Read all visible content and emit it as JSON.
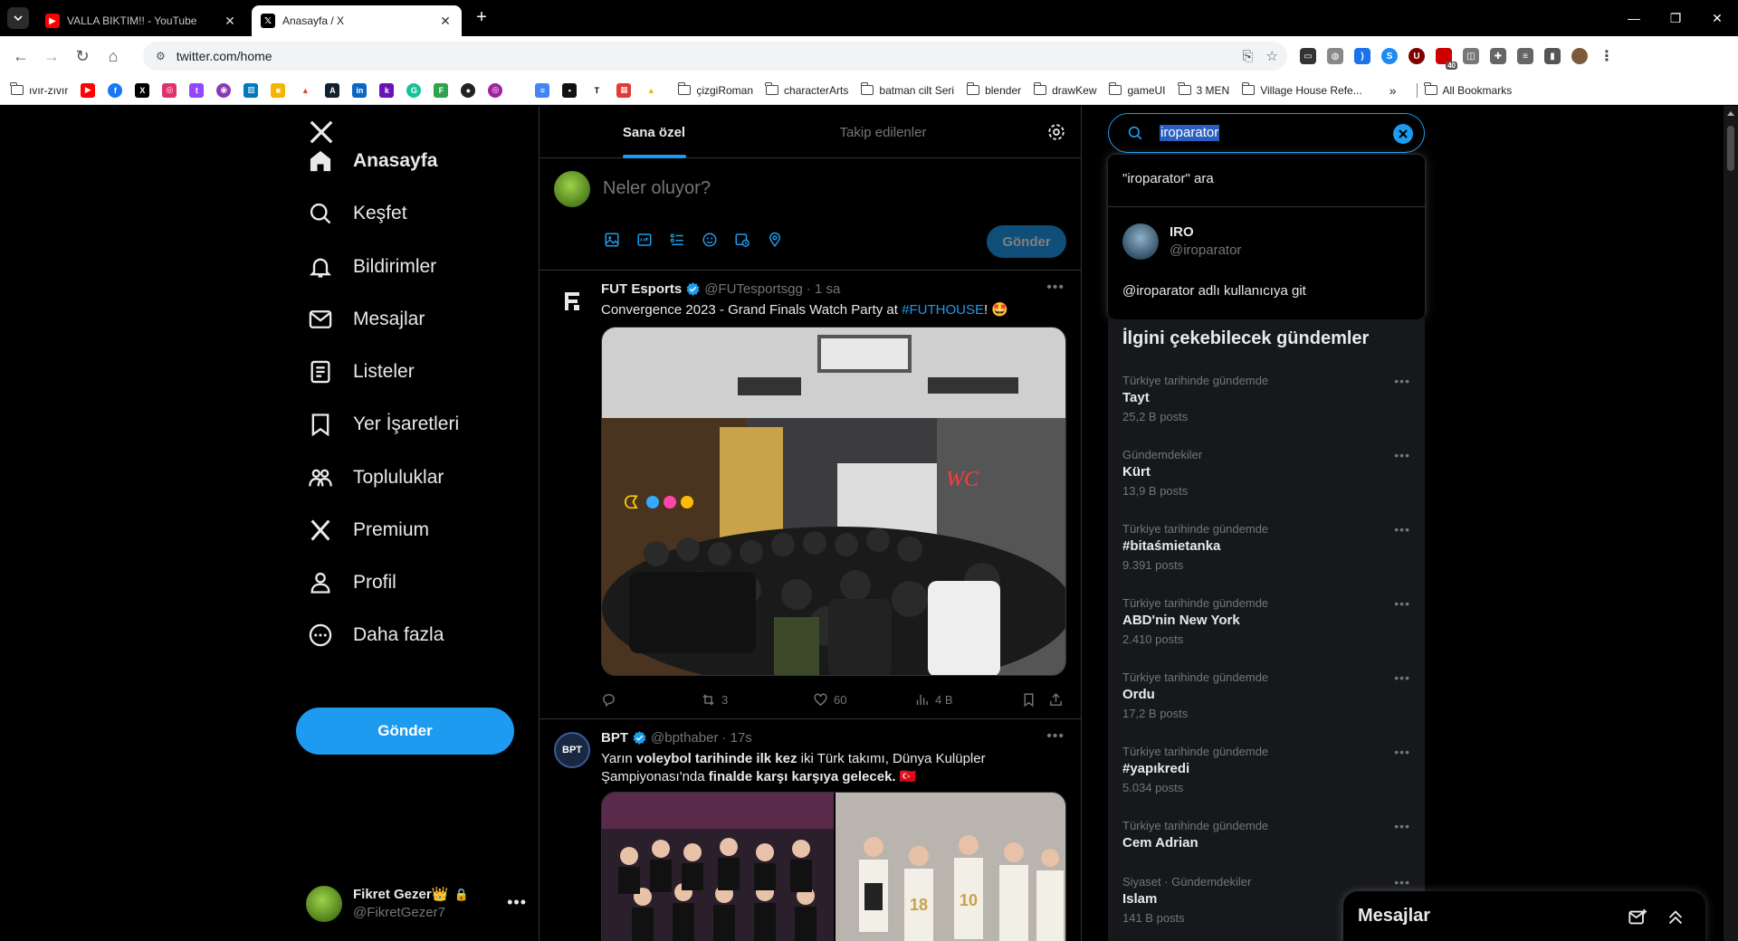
{
  "browser": {
    "tabs": [
      {
        "title": "VALLA BIKTIM!! - YouTube",
        "favicon": "youtube-icon"
      },
      {
        "title": "Anasayfa / X",
        "favicon": "x-icon"
      }
    ],
    "url": "twitter.com/home",
    "bookmarks": [
      {
        "label": "ıvır-zıvır",
        "type": "folder"
      },
      {
        "label": "çizgiRoman",
        "type": "folder"
      },
      {
        "label": "characterArts",
        "type": "folder"
      },
      {
        "label": "batman cilt Seri",
        "type": "folder"
      },
      {
        "label": "blender",
        "type": "folder"
      },
      {
        "label": "drawKew",
        "type": "folder"
      },
      {
        "label": "gameUI",
        "type": "folder"
      },
      {
        "label": "3 MEN",
        "type": "folder"
      },
      {
        "label": "Village House Refe...",
        "type": "folder"
      },
      {
        "label": "All Bookmarks",
        "type": "folder"
      }
    ],
    "extension_badge": "40"
  },
  "nav": {
    "items": [
      {
        "label": "Anasayfa",
        "icon": "home-icon"
      },
      {
        "label": "Keşfet",
        "icon": "search-icon"
      },
      {
        "label": "Bildirimler",
        "icon": "bell-icon"
      },
      {
        "label": "Mesajlar",
        "icon": "mail-icon"
      },
      {
        "label": "Listeler",
        "icon": "list-icon"
      },
      {
        "label": "Yer İşaretleri",
        "icon": "bookmark-icon"
      },
      {
        "label": "Topluluklar",
        "icon": "communities-icon"
      },
      {
        "label": "Premium",
        "icon": "x-icon"
      },
      {
        "label": "Profil",
        "icon": "person-icon"
      },
      {
        "label": "Daha fazla",
        "icon": "more-circle-icon"
      }
    ],
    "post_button": "Gönder",
    "profile": {
      "name": "Fikret Gezer👑",
      "handle": "@FikretGezer7"
    }
  },
  "feed": {
    "tabs": [
      "Sana özel",
      "Takip edilenler"
    ],
    "compose_placeholder": "Neler oluyor?",
    "compose_button": "Gönder",
    "tweets": [
      {
        "name": "FUT Esports",
        "handle": "@FUTesportsgg",
        "time": "· 1 sa",
        "text_before": "Convergence 2023 - Grand Finals Watch Party at ",
        "hashtag": "#FUTHOUSE",
        "text_after": "! 🤩",
        "retweets": "3",
        "likes": "60",
        "views": "4 B"
      },
      {
        "name": "BPT",
        "handle": "@bpthaber",
        "time": "· 17s",
        "text_1": "Yarın ",
        "text_bold_1": "voleybol tarihinde ilk kez",
        "text_2": " iki Türk takımı, Dünya Kulüpler Şampiyonası'nda ",
        "text_bold_2": "finalde karşı karşıya gelecek.",
        "text_3": " 🇹🇷"
      }
    ]
  },
  "search": {
    "query": "iroparator",
    "suggest_search": "\"iroparator\" ara",
    "user_name": "IRO",
    "user_handle": "@iroparator",
    "goto_user": "@iroparator adlı kullanıcıya git"
  },
  "trends": {
    "title": "İlgini çekebilecek gündemler",
    "items": [
      {
        "context": "Türkiye tarihinde gündemde",
        "name": "Tayt",
        "count": "25,2 B posts"
      },
      {
        "context": "Gündemdekiler",
        "name": "Kürt",
        "count": "13,9 B posts"
      },
      {
        "context": "Türkiye tarihinde gündemde",
        "name": "#bitaśmietanka",
        "count": "9.391 posts"
      },
      {
        "context": "Türkiye tarihinde gündemde",
        "name": "ABD'nin New York",
        "count": "2.410 posts"
      },
      {
        "context": "Türkiye tarihinde gündemde",
        "name": "Ordu",
        "count": "17,2 B posts"
      },
      {
        "context": "Türkiye tarihinde gündemde",
        "name": "#yapıkredi",
        "count": "5.034 posts"
      },
      {
        "context": "Türkiye tarihinde gündemde",
        "name": "Cem Adrian",
        "count": ""
      },
      {
        "context": "Siyaset · Gündemdekiler",
        "name": "Islam",
        "count": "141 B posts"
      }
    ]
  },
  "messages_drawer": {
    "title": "Mesajlar"
  },
  "colors": {
    "accent": "#1d9bf0",
    "background": "#000000",
    "secondary_text": "#71767b",
    "border": "#2f3336"
  }
}
